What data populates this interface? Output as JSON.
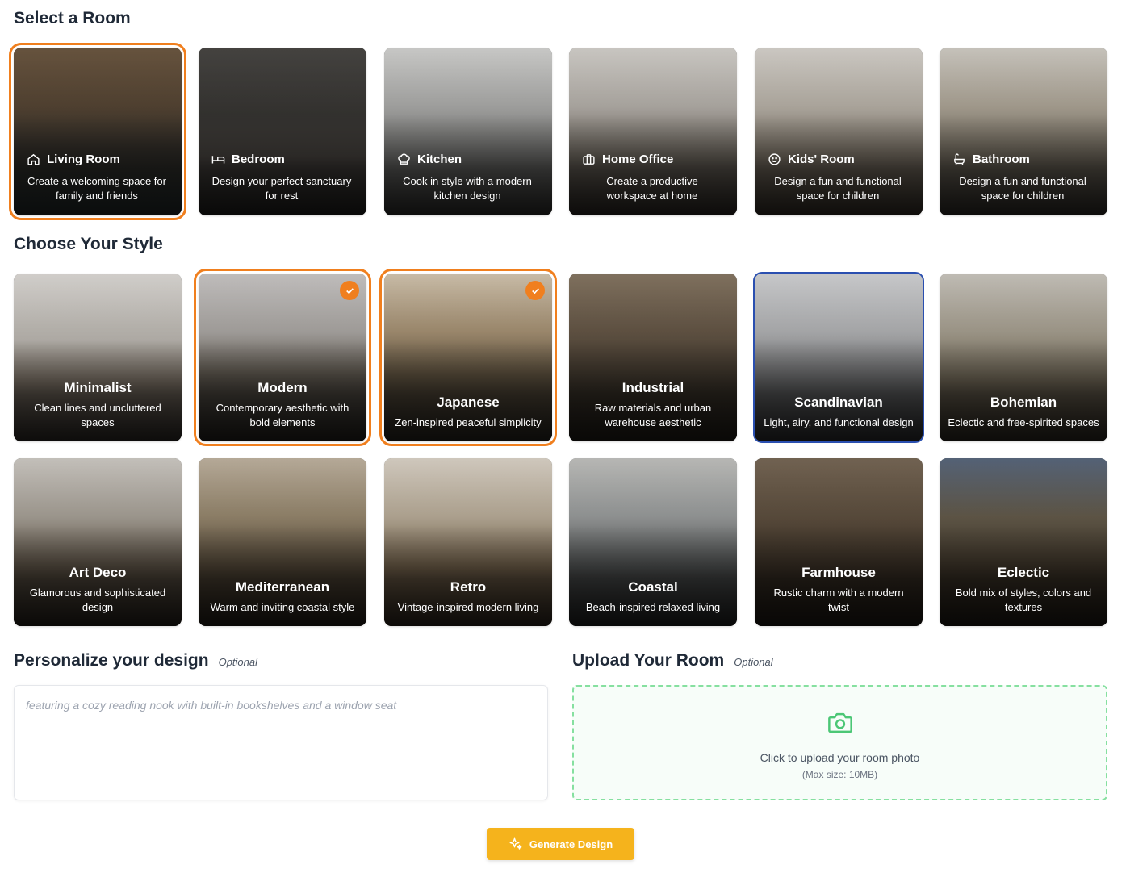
{
  "rooms_section": {
    "title": "Select a Room",
    "items": [
      {
        "label": "Living Room",
        "desc": "Create a welcoming space for family and friends",
        "icon": "home-icon",
        "selected": true
      },
      {
        "label": "Bedroom",
        "desc": "Design your perfect sanctuary for rest",
        "icon": "bed-icon",
        "selected": false
      },
      {
        "label": "Kitchen",
        "desc": "Cook in style with a modern kitchen design",
        "icon": "chef-hat-icon",
        "selected": false
      },
      {
        "label": "Home Office",
        "desc": "Create a productive workspace at home",
        "icon": "briefcase-icon",
        "selected": false
      },
      {
        "label": "Kids' Room",
        "desc": "Design a fun and functional space for children",
        "icon": "smile-icon",
        "selected": false
      },
      {
        "label": "Bathroom",
        "desc": "Design a fun and functional space for children",
        "icon": "bath-icon",
        "selected": false
      }
    ]
  },
  "styles_section": {
    "title": "Choose Your Style",
    "items": [
      {
        "label": "Minimalist",
        "desc": "Clean lines and uncluttered spaces",
        "selected": false
      },
      {
        "label": "Modern",
        "desc": "Contemporary aesthetic with bold elements",
        "selected": true
      },
      {
        "label": "Japanese",
        "desc": "Zen-inspired peaceful simplicity",
        "selected": true
      },
      {
        "label": "Industrial",
        "desc": "Raw materials and urban warehouse aesthetic",
        "selected": false
      },
      {
        "label": "Scandinavian",
        "desc": "Light, airy, and functional design",
        "selected": false
      },
      {
        "label": "Bohemian",
        "desc": "Eclectic and free-spirited spaces",
        "selected": false
      },
      {
        "label": "Art Deco",
        "desc": "Glamorous and sophisticated design",
        "selected": false
      },
      {
        "label": "Mediterranean",
        "desc": "Warm and inviting coastal style",
        "selected": false
      },
      {
        "label": "Retro",
        "desc": "Vintage-inspired modern living",
        "selected": false
      },
      {
        "label": "Coastal",
        "desc": "Beach-inspired relaxed living",
        "selected": false
      },
      {
        "label": "Farmhouse",
        "desc": "Rustic charm with a modern twist",
        "selected": false
      },
      {
        "label": "Eclectic",
        "desc": "Bold mix of styles, colors and textures",
        "selected": false
      }
    ]
  },
  "personalize": {
    "title": "Personalize your design",
    "optional": "Optional",
    "placeholder": "featuring a cozy reading nook with built-in bookshelves and a window seat"
  },
  "upload": {
    "title": "Upload Your Room",
    "optional": "Optional",
    "main_text": "Click to upload your room photo",
    "sub_text": "(Max size: 10MB)"
  },
  "generate_button": {
    "label": "Generate Design"
  },
  "colors": {
    "selected_outline": "#f07f1e",
    "focus_outline": "#2a4fb0",
    "button": "#f5b31c",
    "upload_border": "#86e0a0"
  }
}
